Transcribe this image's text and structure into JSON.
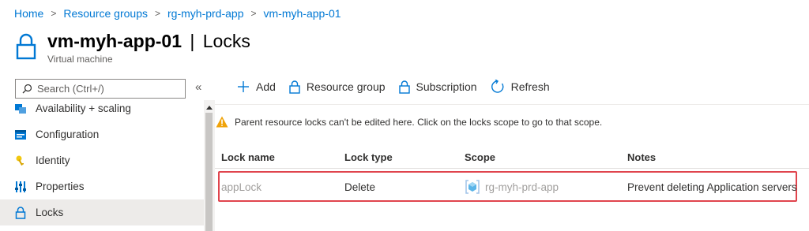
{
  "breadcrumb": {
    "items": [
      "Home",
      "Resource groups",
      "rg-myh-prd-app",
      "vm-myh-app-01"
    ],
    "separator": ">"
  },
  "header": {
    "name": "vm-myh-app-01",
    "divider": "|",
    "page": "Locks",
    "subtitle": "Virtual machine"
  },
  "search": {
    "placeholder": "Search (Ctrl+/)",
    "collapse_label": "«"
  },
  "sidebar": {
    "items": [
      {
        "label": "Availability + scaling",
        "icon": "availability-icon",
        "active": false
      },
      {
        "label": "Configuration",
        "icon": "configuration-icon",
        "active": false
      },
      {
        "label": "Identity",
        "icon": "identity-icon",
        "active": false
      },
      {
        "label": "Properties",
        "icon": "properties-icon",
        "active": false
      },
      {
        "label": "Locks",
        "icon": "lock-icon",
        "active": true
      }
    ]
  },
  "toolbar": {
    "add": "Add",
    "resource_group": "Resource group",
    "subscription": "Subscription",
    "refresh": "Refresh"
  },
  "warning": {
    "text": "Parent resource locks can't be edited here. Click on the locks scope to go to that scope."
  },
  "table": {
    "columns": [
      "Lock name",
      "Lock type",
      "Scope",
      "Notes"
    ],
    "rows": [
      {
        "lock_name": "appLock",
        "lock_type": "Delete",
        "scope": "rg-myh-prd-app",
        "notes": "Prevent deleting Application servers"
      }
    ]
  },
  "colors": {
    "link": "#0078d4",
    "highlight_border": "#e0444d",
    "warning": "#f0a30a",
    "active_bg": "#edebe9"
  }
}
